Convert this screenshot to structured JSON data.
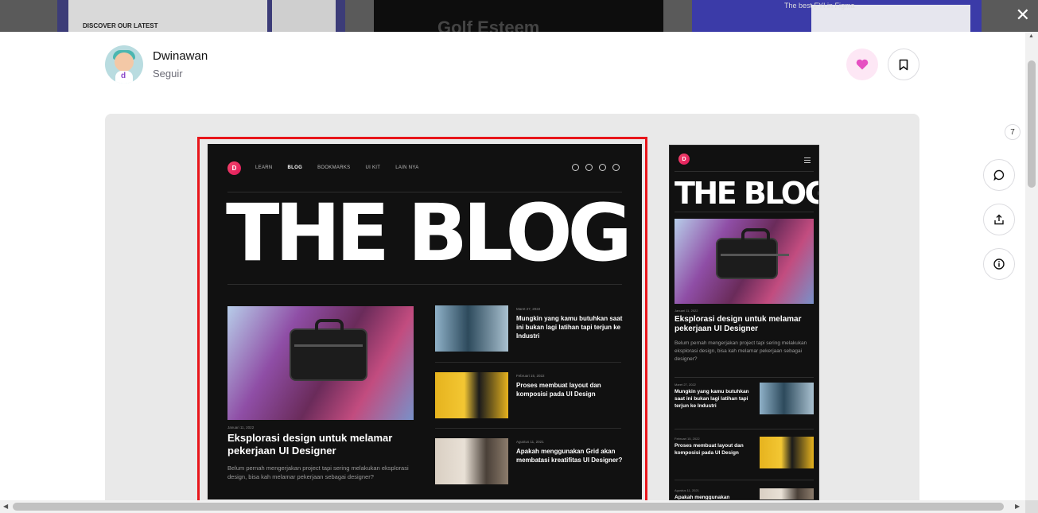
{
  "background": {
    "thumb1_caption": "DISCOVER OUR LATEST",
    "thumb2_caption": "Golf Esteem",
    "thumb3_caption": "The best FYI in Figma"
  },
  "author": {
    "name": "Dwinawan",
    "follow_label": "Seguir",
    "avatar_letter": "d"
  },
  "actions": {
    "like_icon": "heart-icon",
    "save_icon": "bookmark-icon",
    "comment_count": "7"
  },
  "shot": {
    "logo_letter": "D",
    "nav": [
      "LEARN",
      "BLOG",
      "BOOKMARKS",
      "UI KIT",
      "LAIN NYA"
    ],
    "nav_active": "BLOG",
    "hero_title": "THE BLOG",
    "featured": {
      "date": "Januari 11, 2022",
      "title": "Eksplorasi design untuk melamar pekerjaan UI Designer",
      "description": "Belum pernah mengerjakan project tapi sering melakukan eksplorasi design, bisa kah melamar pekerjaan sebagai designer?"
    },
    "articles": [
      {
        "date": "Maret 27, 2022",
        "title": "Mungkin yang kamu butuhkan saat ini bukan lagi latihan tapi terjun ke Industri"
      },
      {
        "date": "Februari 15, 2022",
        "title": "Proses membuat layout dan komposisi pada UI Design"
      },
      {
        "date": "Agustus 11, 2021",
        "title": "Apakah menggunakan Grid akan membatasi kreatifitas UI Designer?"
      }
    ],
    "mobile_partial_title": "Apakah menggunakan"
  },
  "colors": {
    "highlight_border": "#e8161b",
    "like_bg": "#fde7f5",
    "like_heart": "#e64fc2",
    "shot_bg": "#111111",
    "logo": "#e0195a"
  }
}
